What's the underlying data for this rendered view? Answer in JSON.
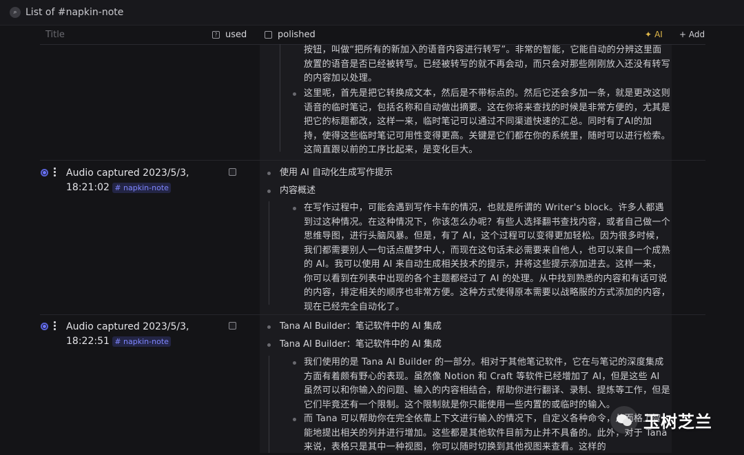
{
  "view": {
    "icon": "search-icon",
    "title": "List of #napkin-note"
  },
  "columns": {
    "title": "Title",
    "used": "used",
    "polished": "polished",
    "ai": "AI",
    "add": "+ Add"
  },
  "row0": {
    "para1": "按钮，叫做“把所有的新加入的语音内容进行转写”。非常的智能，它能自动的分辨这里面放置的语音是否已经被转写。已经被转写的就不再会动，而只会对那些刚刚放入还没有转写的内容加以处理。",
    "para2": "这里呢，首先是把它转换成文本，然后是不带标点的。然后它还会多加一条，就是更改这则语音的临时笔记，包括名称和自动做出摘要。这在你将来查找的时候是非常方便的，尤其是把它的标题都改，这样一来，临时笔记可以通过不同渠道快速的汇总。同时有了AI的加持，使得这些临时笔记可用性变得更高。关键是它们都在你的系统里，随时可以进行检索。这简直跟以前的工序比起来，是变化巨大。"
  },
  "row1": {
    "title_line1": "Audio captured 2023/5/3,",
    "title_line2": "18:21:02",
    "tag": "# napkin-note",
    "bullet1": "使用 AI 自动化生成写作提示",
    "bullet2": "内容概述",
    "para": "在写作过程中，可能会遇到写作卡车的情况，也就是所谓的 Writer's block。许多人都遇到过这种情况。在这种情况下，你该怎么办呢？有些人选择翻书查找内容，或者自己做一个思维导图，进行头脑风暴。但是，有了 AI，这个过程可以变得更加轻松。因为很多时候，我们都需要别人一句话点醒梦中人，而现在这句话未必需要来自他人，也可以来自一个成熟的 AI。我可以使用 AI 来自动生成相关技术的提示，并将这些提示添加进去。这样一来，你可以看到在列表中出现的各个主题都经过了 AI 的处理。从中找到熟悉的内容和有话可说的内容，排定相关的顺序也非常方便。这种方式使得原本需要以战略服的方式添加的内容，现在已经完全自动化了。"
  },
  "row2": {
    "title_line1": "Audio captured 2023/5/3,",
    "title_line2": "18:22:51",
    "tag": "# napkin-note",
    "bullet1": "Tana AI Builder：笔记软件中的 AI 集成",
    "bullet2": "Tana AI Builder：笔记软件中的 AI 集成",
    "para1": "我们使用的是 Tana AI Builder 的一部分。相对于其他笔记软件，它在与笔记的深度集成方面有着颇有野心的表现。虽然像 Notion 和 Craft 等软件已经增加了 AI，但是这些 AI 虽然可以和你输入的问题、输入的内容相结合，帮助你进行翻译、录制、提炼等工作，但是它们毕竟还有一个限制。这个限制就是你只能使用一些内置的或临时的输入。",
    "para2": "而 Tana 可以帮助你在完全依靠上下文进行输入的情况下，自定义各种命令，从而格上智能地提出相关的列并进行增加。这些都是其他软件目前为止并不具备的。此外，对于 Tana 来说，表格只是其中一种视图，你可以随时切换到其他视图来查看。这样的"
  },
  "watermark": "玉树芝兰",
  "colors": {
    "accent": "#6b74ff",
    "ai": "#e0b84a",
    "background": "#141417"
  }
}
